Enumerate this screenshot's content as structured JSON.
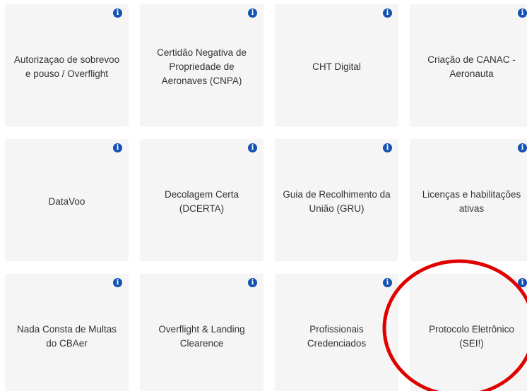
{
  "services": {
    "info_icon_glyph": "i",
    "info_icon_color": "#1351b4",
    "cards": [
      {
        "label_lines": [
          "Autorizaçao de sobrevoo",
          "e pouso / Overflight"
        ]
      },
      {
        "label_lines": [
          "Certidão Negativa de",
          "Propriedade de",
          "Aeronaves (CNPA)"
        ]
      },
      {
        "label_lines": [
          "CHT Digital"
        ]
      },
      {
        "label_lines": [
          "Criação de CANAC -",
          "Aeronauta"
        ]
      },
      {
        "label_lines": [
          "DataVoo"
        ]
      },
      {
        "label_lines": [
          "Decolagem Certa",
          "(DCERTA)"
        ]
      },
      {
        "label_lines": [
          "Guia de Recolhimento da",
          "União (GRU)"
        ]
      },
      {
        "label_lines": [
          "Licenças e habilitações",
          "ativas"
        ]
      },
      {
        "label_lines": [
          "Nada Consta de Multas",
          "do CBAer"
        ]
      },
      {
        "label_lines": [
          "Overflight & Landing",
          "Clearence"
        ]
      },
      {
        "label_lines": [
          "Profissionais",
          "Credenciados"
        ]
      },
      {
        "label_lines": [
          "Protocolo Eletrônico",
          "(SEI!)"
        ]
      }
    ]
  },
  "annotation": {
    "shape": "ellipse",
    "color": "#e00000",
    "highlighted_card": "Protocolo Eletrônico (SEI!)"
  }
}
